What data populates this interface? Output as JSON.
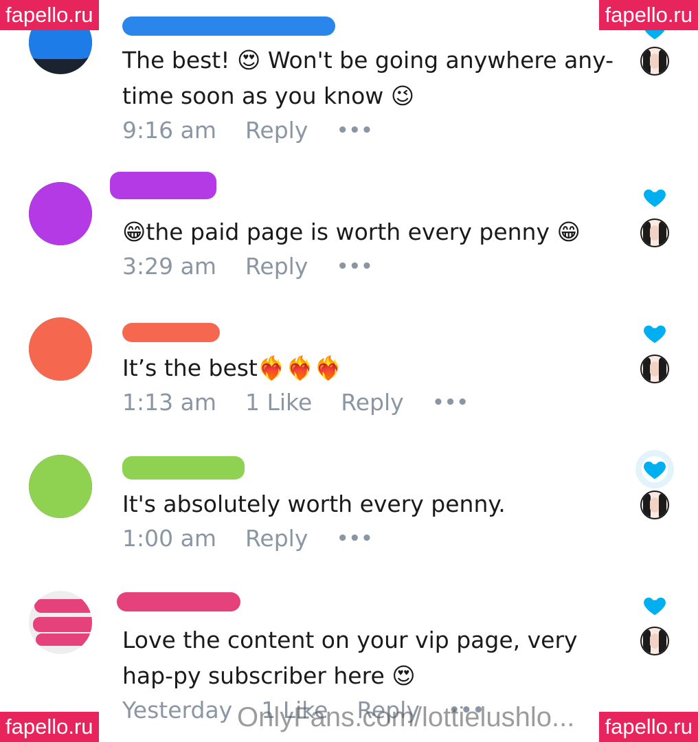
{
  "watermarks": {
    "corner_label": "fapello.ru",
    "bottom_text": "OnlyFans.com/lottielushlo..."
  },
  "colors": {
    "heart": "#00aff0",
    "meta_text": "#8a96a3",
    "badge_bg": "#e8245c"
  },
  "comments": [
    {
      "text": "The best! 😍 Won't be going anywhere any-time soon as you know 😉",
      "time": "9:16 am",
      "likes": "",
      "reply": "Reply",
      "more": "•••",
      "liked": true
    },
    {
      "text": "😁the paid page is worth every penny 😁",
      "time": "3:29 am",
      "likes": "",
      "reply": "Reply",
      "more": "•••",
      "liked": true
    },
    {
      "text": "It’s the best❤️‍🔥❤️‍🔥❤️‍🔥",
      "time": "1:13 am",
      "likes": "1 Like",
      "reply": "Reply",
      "more": "•••",
      "liked": true
    },
    {
      "text": "It's absolutely worth every penny.",
      "time": "1:00 am",
      "likes": "",
      "reply": "Reply",
      "more": "•••",
      "liked": true
    },
    {
      "text": "Love the content on your vip page, very hap-py subscriber here 😍",
      "time": "Yesterday",
      "likes": "1 Like",
      "reply": "Reply",
      "more": "•••",
      "liked": true
    }
  ]
}
